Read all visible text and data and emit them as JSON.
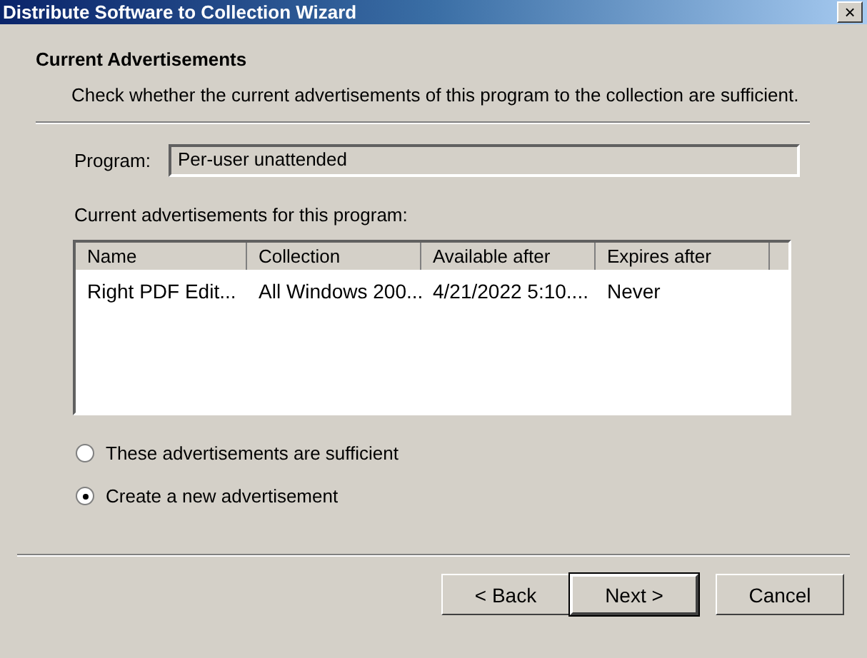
{
  "window": {
    "title": "Distribute Software to Collection Wizard",
    "close": "×"
  },
  "header": {
    "title": "Current Advertisements",
    "description": "Check whether the current advertisements of this program to the collection are sufficient."
  },
  "program": {
    "label": "Program:",
    "value": "Per-user unattended"
  },
  "list": {
    "label": "Current advertisements for this program:",
    "columns": [
      "Name",
      "Collection",
      "Available after",
      "Expires after"
    ],
    "rows": [
      [
        "Right PDF Edit...",
        "All Windows 200...",
        "4/21/2022 5:10....",
        "Never"
      ]
    ]
  },
  "options": [
    {
      "label": "These advertisements are sufficient",
      "selected": false
    },
    {
      "label": "Create a new advertisement",
      "selected": true
    }
  ],
  "buttons": [
    {
      "label": "< Back",
      "default": false
    },
    {
      "label": "Next >",
      "default": true
    },
    {
      "label": "Cancel",
      "default": false
    }
  ]
}
